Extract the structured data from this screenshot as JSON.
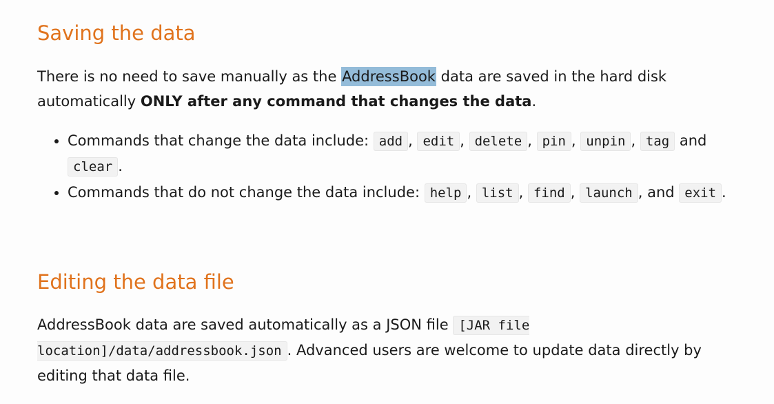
{
  "section1": {
    "heading": "Saving the data",
    "intro": {
      "before_highlight": "There is no need to save manually as the ",
      "highlight": "AddressBook",
      "after_highlight": " data are saved in the hard disk automatically ",
      "bold": "ONLY after any command that changes the data",
      "end": "."
    },
    "bullets": [
      {
        "lead": "Commands that change the data include: ",
        "commands": [
          "add",
          "edit",
          "delete",
          "pin",
          "unpin",
          "tag",
          "clear"
        ],
        "conjunction": "and",
        "end": "."
      },
      {
        "lead": "Commands that do not change the data include: ",
        "commands": [
          "help",
          "list",
          "find",
          "launch",
          "exit"
        ],
        "conjunction": ", and",
        "end": "."
      }
    ]
  },
  "section2": {
    "heading": "Editing the data file",
    "text_before": "AddressBook data are saved automatically as a JSON file ",
    "code": "[JAR file location]/data/addressbook.json",
    "text_after": ". Advanced users are welcome to update data directly by editing that data file."
  },
  "colors": {
    "heading": "#e0731d",
    "highlight": "#94bcd9",
    "code_bg": "#f2f2f2"
  }
}
